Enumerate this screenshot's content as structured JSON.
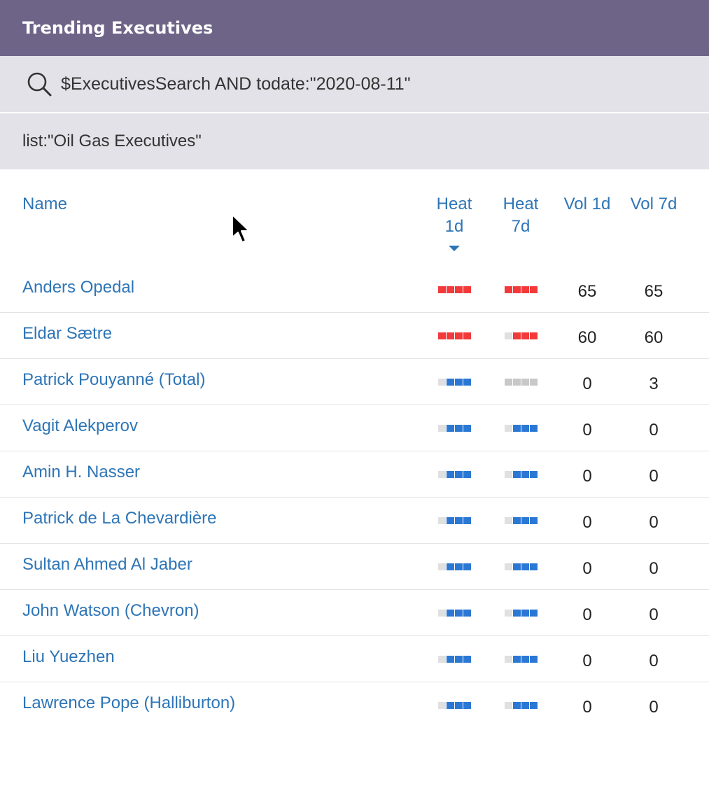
{
  "title": "Trending Executives",
  "search": {
    "query": "$ExecutivesSearch AND todate:\"2020-08-11\""
  },
  "filter": {
    "list": "list:\"Oil Gas Executives\""
  },
  "columns": {
    "name": "Name",
    "heat1_line1": "Heat",
    "heat1_line2": "1d",
    "heat7_line1": "Heat",
    "heat7_line2": "7d",
    "vol1": "Vol 1d",
    "vol7": "Vol 7d"
  },
  "colors": {
    "hot": "#f23a3a",
    "cool": "#2b78d4",
    "empty": "#e0e0e0",
    "neutral": "#c8c8c8"
  },
  "rows": [
    {
      "name": "Anders Opedal",
      "heat1": {
        "level": 4,
        "tone": "hot"
      },
      "heat7": {
        "level": 4,
        "tone": "hot"
      },
      "vol1": "65",
      "vol7": "65"
    },
    {
      "name": "Eldar Sætre",
      "heat1": {
        "level": 4,
        "tone": "hot"
      },
      "heat7": {
        "level": 3,
        "tone": "hot"
      },
      "vol1": "60",
      "vol7": "60"
    },
    {
      "name": "Patrick Pouyanné (Total)",
      "heat1": {
        "level": 3,
        "tone": "cool"
      },
      "heat7": {
        "level": 4,
        "tone": "neutral"
      },
      "vol1": "0",
      "vol7": "3"
    },
    {
      "name": "Vagit Alekperov",
      "heat1": {
        "level": 3,
        "tone": "cool"
      },
      "heat7": {
        "level": 3,
        "tone": "cool"
      },
      "vol1": "0",
      "vol7": "0"
    },
    {
      "name": "Amin H. Nasser",
      "heat1": {
        "level": 3,
        "tone": "cool"
      },
      "heat7": {
        "level": 3,
        "tone": "cool"
      },
      "vol1": "0",
      "vol7": "0"
    },
    {
      "name": "Patrick de La Chevardière",
      "heat1": {
        "level": 3,
        "tone": "cool"
      },
      "heat7": {
        "level": 3,
        "tone": "cool"
      },
      "vol1": "0",
      "vol7": "0"
    },
    {
      "name": "Sultan Ahmed Al Jaber",
      "heat1": {
        "level": 3,
        "tone": "cool"
      },
      "heat7": {
        "level": 3,
        "tone": "cool"
      },
      "vol1": "0",
      "vol7": "0"
    },
    {
      "name": "John Watson (Chevron)",
      "heat1": {
        "level": 3,
        "tone": "cool"
      },
      "heat7": {
        "level": 3,
        "tone": "cool"
      },
      "vol1": "0",
      "vol7": "0"
    },
    {
      "name": "Liu Yuezhen",
      "heat1": {
        "level": 3,
        "tone": "cool"
      },
      "heat7": {
        "level": 3,
        "tone": "cool"
      },
      "vol1": "0",
      "vol7": "0"
    },
    {
      "name": "Lawrence Pope (Halliburton)",
      "heat1": {
        "level": 3,
        "tone": "cool"
      },
      "heat7": {
        "level": 3,
        "tone": "cool"
      },
      "vol1": "0",
      "vol7": "0"
    }
  ],
  "icons": {
    "search": "magnifier-icon",
    "sort": "sort-desc-icon",
    "cursor": "mouse-pointer-icon"
  }
}
